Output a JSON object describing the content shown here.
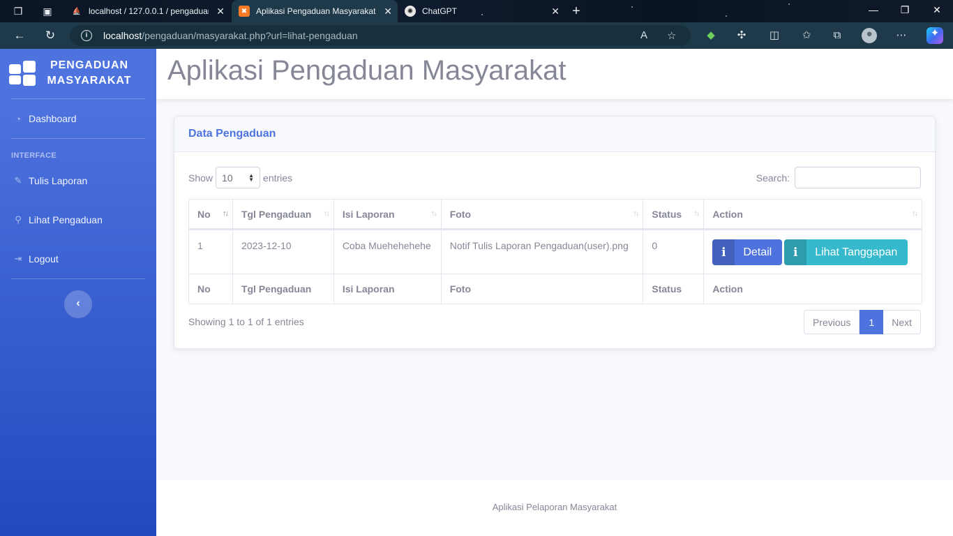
{
  "browser": {
    "tabs": [
      {
        "title": "localhost / 127.0.0.1 / pengaduan",
        "favicon": "phpmyadmin-icon"
      },
      {
        "title": "Aplikasi Pengaduan Masyarakat",
        "favicon": "xampp-icon",
        "active": true
      },
      {
        "title": "ChatGPT",
        "favicon": "chatgpt-icon"
      }
    ],
    "url_host": "localhost",
    "url_path": "/pengaduan/masyarakat.php?url=lihat-pengaduan"
  },
  "sidebar": {
    "brand_line1": "PENGADUAN",
    "brand_line2": "MASYARAKAT",
    "heading": "INTERFACE",
    "items": [
      {
        "label": "Dashboard",
        "icon": "tachometer-icon"
      },
      {
        "label": "Tulis Laporan",
        "icon": "edit-icon"
      },
      {
        "label": "Lihat Pengaduan",
        "icon": "search-icon"
      },
      {
        "label": "Logout",
        "icon": "sign-out-icon"
      }
    ],
    "colors": {
      "top": "#4e73df",
      "bottom": "#224abe"
    }
  },
  "header": {
    "title": "Aplikasi Pengaduan Masyarakat"
  },
  "card": {
    "title": "Data Pengaduan",
    "show_label": "Show",
    "entries_label": "entries",
    "page_length": "10",
    "search_label": "Search:",
    "columns": [
      "No",
      "Tgl Pengaduan",
      "Isi Laporan",
      "Foto",
      "Status",
      "Action"
    ],
    "rows": [
      {
        "no": "1",
        "tgl": "2023-12-10",
        "isi": "Coba Muehehehehe",
        "foto": "Notif Tulis Laporan Pengaduan(user).png",
        "status": "0"
      }
    ],
    "btn_detail": "Detail",
    "btn_tanggapan": "Lihat Tanggapan",
    "info": "Showing 1 to 1 of 1 entries",
    "pager": {
      "previous": "Previous",
      "current": "1",
      "next": "Next"
    }
  },
  "footer": {
    "text": "Aplikasi Pelaporan Masyarakat"
  }
}
